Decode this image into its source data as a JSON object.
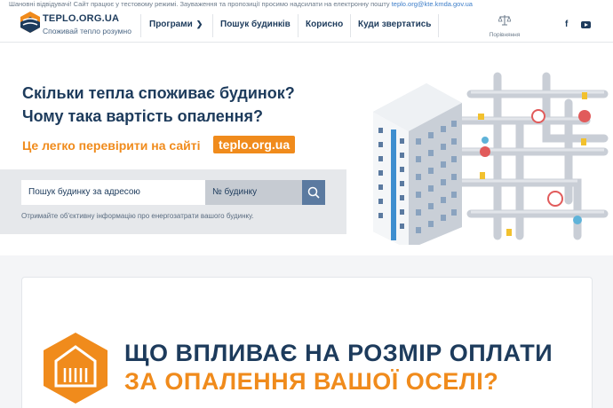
{
  "notice": {
    "text": "Шановні відвідувачі! Сайт працює у тестовому режимі. Зауваження та пропозиції просимо надсилати на електронну пошту ",
    "email": "teplo.org@kte.kmda.gov.ua"
  },
  "header": {
    "logo_name": "TEPLO.ORG.UA",
    "logo_tagline": "Споживай тепло розумно",
    "nav": [
      {
        "label": "Програми",
        "has_dropdown": true
      },
      {
        "label": "Пошук будинків"
      },
      {
        "label": "Корисно"
      },
      {
        "label": "Куди звертатись"
      }
    ],
    "compare_label": "Порівняння",
    "social": {
      "facebook": "f"
    }
  },
  "hero": {
    "title_line1": "Скільки тепла споживає будинок?",
    "title_line2": "Чому така вартість опалення?",
    "promo_text": "Це легко перевірити на сайті",
    "promo_site": "teplo.org.ua",
    "search": {
      "address_placeholder": "Пошук будинку за адресою",
      "number_placeholder": "№ будинку",
      "hint": "Отримайте об'єктивну інформацію про енергозатрати вашого будинку."
    }
  },
  "card": {
    "title_line1": "ЩО ВПЛИВАЄ НА РОЗМІР ОПЛАТИ",
    "title_line2": "ЗА ОПАЛЕННЯ ВАШОЇ ОСЕЛІ?"
  },
  "colors": {
    "brand_dark": "#1d3b5c",
    "accent_orange": "#f08b1c",
    "search_button": "#5b7aa0"
  }
}
